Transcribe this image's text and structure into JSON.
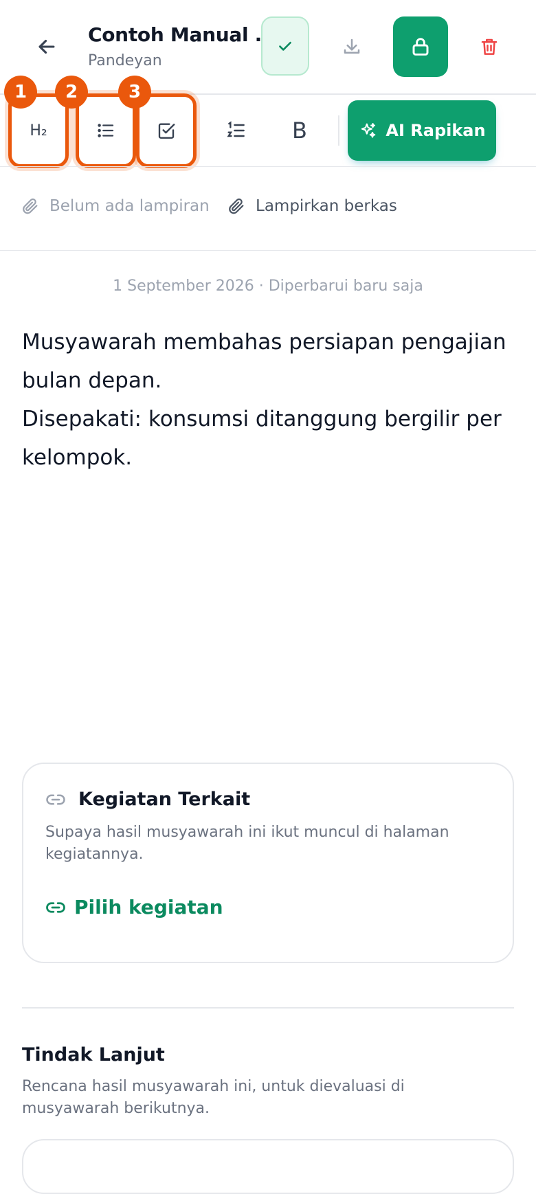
{
  "header": {
    "title": "Contoh Manual ...",
    "subtitle": "Pandeyan"
  },
  "toolbar": {
    "items": [
      {
        "name": "heading-2",
        "glyph": "H₂",
        "badge": "1"
      },
      {
        "name": "bullet-list",
        "badge": "2"
      },
      {
        "name": "checklist",
        "badge": "3"
      },
      {
        "name": "numbered-list"
      },
      {
        "name": "bold",
        "glyph": "B"
      }
    ],
    "ai_label": "AI Rapikan"
  },
  "attachments": {
    "empty_label": "Belum ada lampiran",
    "add_label": "Lampirkan berkas"
  },
  "note": {
    "meta": "1 September 2026 · Diperbarui baru saja",
    "paragraphs": [
      "Musyawarah membahas persiapan pengajian bulan depan.",
      "Disepakati: konsumsi ditanggung bergilir per kelompok."
    ]
  },
  "related": {
    "title": "Kegiatan Terkait",
    "description": "Supaya hasil musyawarah ini ikut muncul di halaman kegiatannya.",
    "link_label": "Pilih kegiatan"
  },
  "followup": {
    "title": "Tindak Lanjut",
    "description": "Rencana hasil musyawarah ini, untuk dievaluasi di musyawarah berikutnya."
  },
  "colors": {
    "primary": "#0e9f6e",
    "highlight": "#ea580c",
    "danger": "#ef4444"
  }
}
